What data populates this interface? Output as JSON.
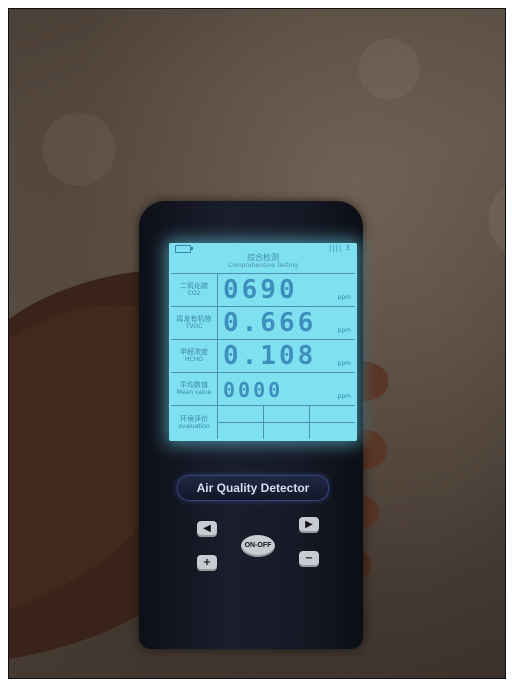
{
  "screen": {
    "header_cn": "综合检测",
    "header_en": "Comprehensive Testing",
    "signal": "||||  3",
    "rows": [
      {
        "label_cn": "二氧化碳",
        "label_en": "CO2",
        "value": "0690",
        "unit": "ppm"
      },
      {
        "label_cn": "挥发有机物",
        "label_en": "TVOC",
        "value": "0.666",
        "unit": "ppm"
      },
      {
        "label_cn": "甲醛浓度",
        "label_en": "HCHO",
        "value": "0.108",
        "unit": "ppm"
      },
      {
        "label_cn": "平均数值",
        "label_en": "Mean value",
        "value": "0000",
        "unit": "ppm"
      }
    ],
    "evaluation": {
      "label_cn": "环境评价",
      "label_en": "evaluation"
    }
  },
  "device": {
    "brand": "Air Quality Detector",
    "buttons": {
      "left": "◀",
      "right": "▶",
      "plus": "+",
      "minus": "−",
      "power": "ON-OFF"
    }
  },
  "colors": {
    "screen": "#7fe1ef",
    "segment": "#3f8fbe",
    "body": "#161a26"
  }
}
